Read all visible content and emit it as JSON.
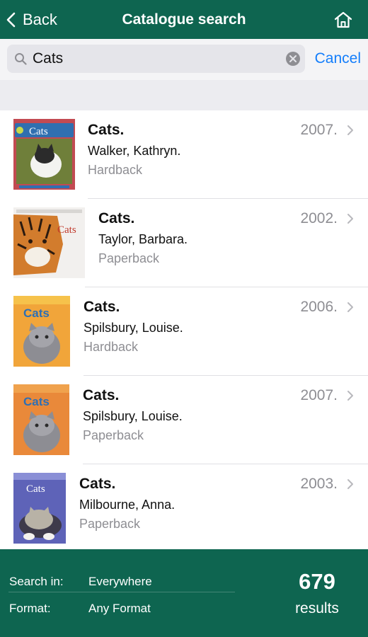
{
  "colors": {
    "brand": "#0e6550",
    "accent": "#147efb",
    "muted": "#8e8e93"
  },
  "nav": {
    "back_label": "Back",
    "title": "Catalogue search",
    "home_icon": "home-icon"
  },
  "search": {
    "value": "Cats",
    "cancel_label": "Cancel"
  },
  "results": [
    {
      "title": "Cats.",
      "author": "Walker, Kathryn.",
      "format": "Hardback",
      "year": "2007.",
      "cover_text": "Cats"
    },
    {
      "title": "Cats.",
      "author": "Taylor, Barbara.",
      "format": "Paperback",
      "year": "2002.",
      "cover_text": "Cats"
    },
    {
      "title": "Cats.",
      "author": "Spilsbury, Louise.",
      "format": "Hardback",
      "year": "2006.",
      "cover_text": "Cats"
    },
    {
      "title": "Cats.",
      "author": "Spilsbury, Louise.",
      "format": "Paperback",
      "year": "2007.",
      "cover_text": "Cats"
    },
    {
      "title": "Cats.",
      "author": "Milbourne, Anna.",
      "format": "Paperback",
      "year": "2003.",
      "cover_text": "Cats"
    }
  ],
  "filters": {
    "search_in_label": "Search in:",
    "search_in_value": "Everywhere",
    "format_label": "Format:",
    "format_value": "Any Format"
  },
  "count": {
    "value": "679",
    "label": "results"
  }
}
